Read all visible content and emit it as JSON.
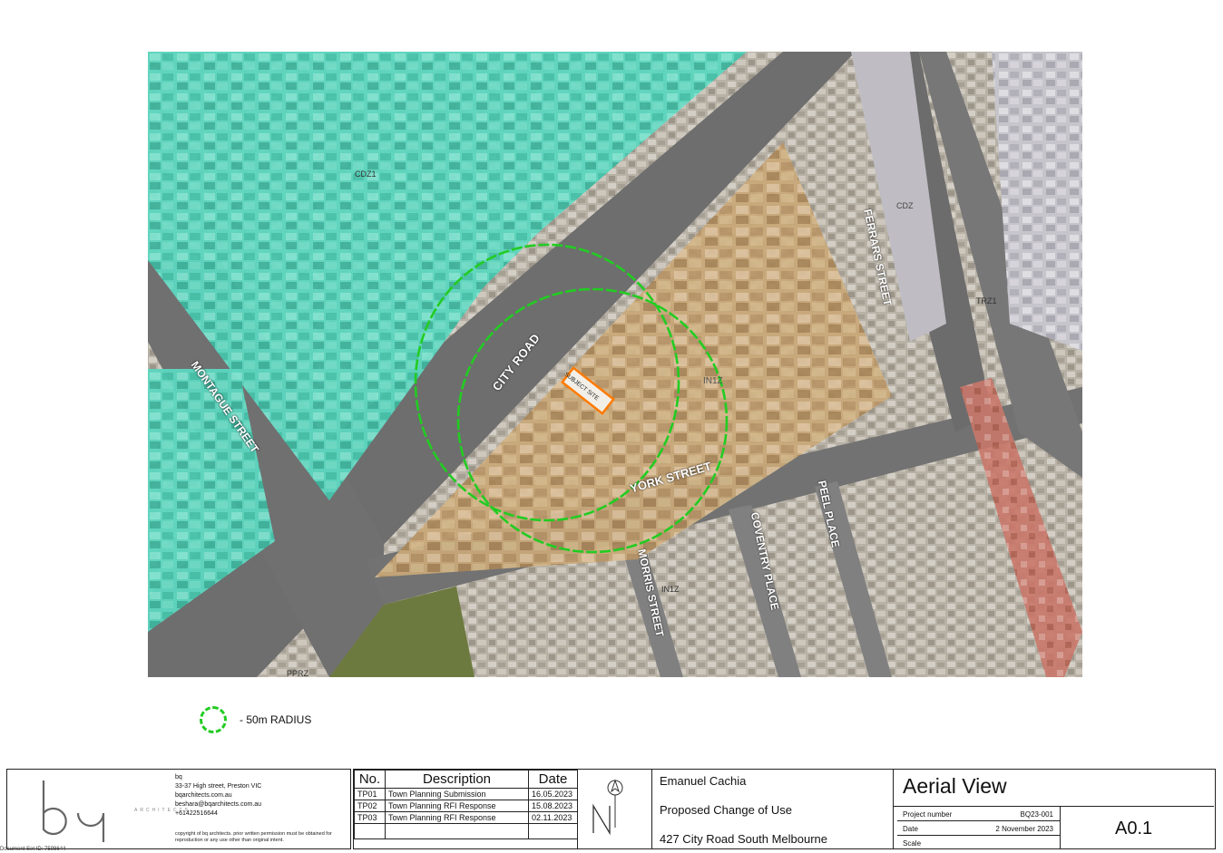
{
  "map": {
    "street_labels": {
      "city_road": "CITY ROAD",
      "montague_street": "MONTAGUE STREET",
      "york_street": "YORK STREET",
      "ferrars_street": "FERRARS STREET",
      "morris_street": "MORRIS STREET",
      "coventry_place": "COVENTRY PLACE",
      "peel_place": "PEEL PLACE"
    },
    "zone_labels": {
      "cdz1": "CDZ1",
      "cdz_right": "CDZ",
      "trz1": "TRZ1",
      "in1z": "IN1Z",
      "in1z_lower": "IN1Z",
      "ppr": "PPRZ"
    },
    "subject_site": "SUBJECT SITE",
    "colors": {
      "cdz": "#4fd1b8",
      "industrial": "#c9a46b",
      "heritage": "#c86b5e",
      "radius_ring": "#22cc22",
      "subject_outline": "#ff7a00"
    }
  },
  "legend": {
    "label": "- 50m RADIUS"
  },
  "title_block": {
    "firm": {
      "logo": "bq",
      "wordmark": "ARCHITECTS",
      "name": "bq",
      "address": "33-37 High street, Preston VIC",
      "website": "bqarchitects.com.au",
      "email": "beshara@bqarchitects.com.au",
      "phone": "+61422516644",
      "copyright": "copyright of bq architects. prior written permission must be obtained for reproduction or any use other than original intent."
    },
    "revisions": {
      "headers": [
        "No.",
        "Description",
        "Date"
      ],
      "rows": [
        [
          "TP01",
          "Town Planning Submission",
          "16.05.2023"
        ],
        [
          "TP02",
          "Town Planning RFI Response",
          "15.08.2023"
        ],
        [
          "TP03",
          "Town Planning RFI Response",
          "02.11.2023"
        ]
      ]
    },
    "client": "Emanuel Cachia",
    "project": "Proposed Change of Use",
    "address": "427 City Road South Melbourne",
    "sheet_title": "Aerial View",
    "project_number_label": "Project number",
    "project_number": "BQ23-001",
    "date_label": "Date",
    "date": "2 November 2023",
    "scale_label": "Scale",
    "sheet_number": "A0.1"
  },
  "footer": {
    "document_id": "Document Set ID: 7598644"
  }
}
